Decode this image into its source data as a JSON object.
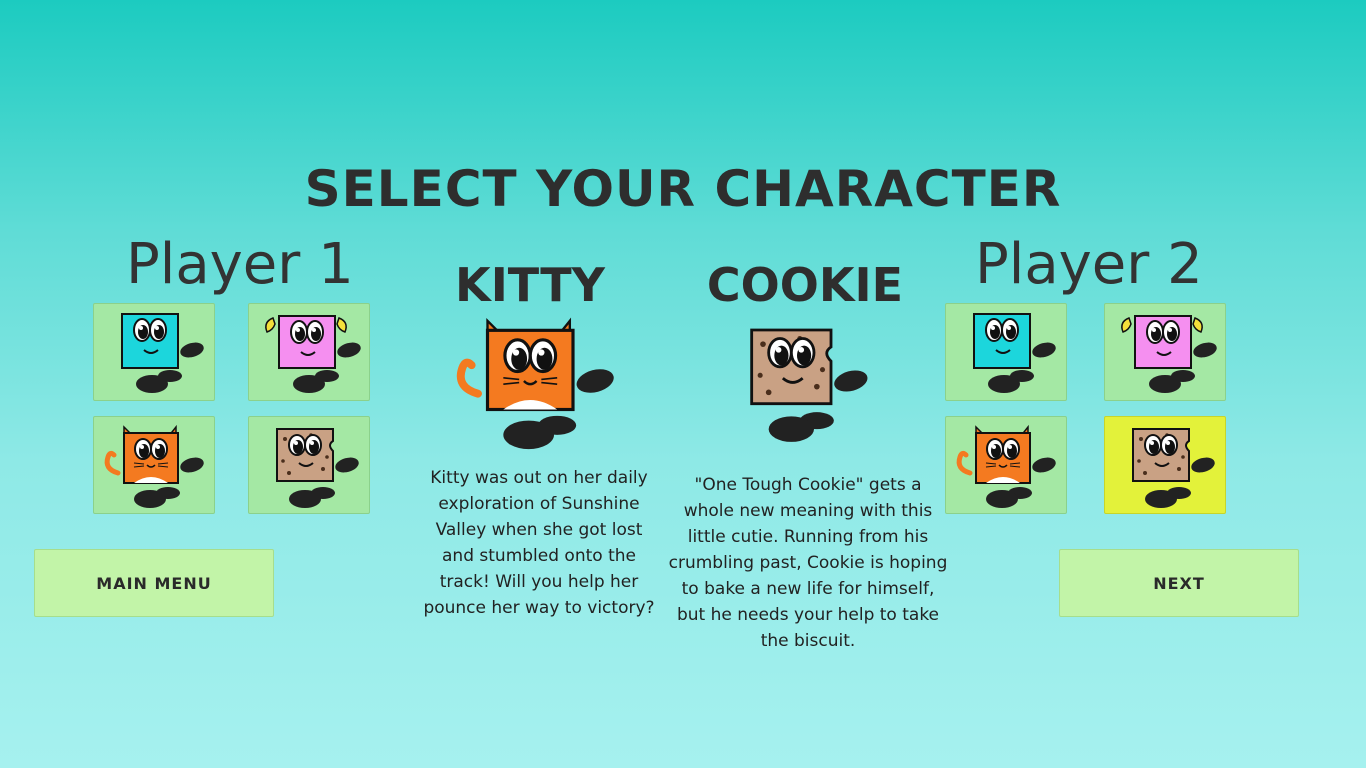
{
  "title": "SELECT YOUR CHARACTER",
  "players": {
    "p1": {
      "label": "Player 1"
    },
    "p2": {
      "label": "Player 2"
    }
  },
  "characters": {
    "kitty": {
      "name": "KITTY",
      "description": "Kitty was out on her daily exploration of Sunshine Valley when she got lost and stumbled onto the track! Will you help her pounce her way to victory?",
      "color": "#f47a20"
    },
    "cookie": {
      "name": "COOKIE",
      "description": "\"One Tough Cookie\" gets a whole new meaning with this little cutie. Running from his crumbling past, Cookie is hoping to bake a new life for himself, but he needs your help to take the biscuit.",
      "color": "#c9a184"
    }
  },
  "grid_characters": [
    "blue",
    "pink",
    "kitty",
    "cookie"
  ],
  "selections": {
    "p1": "kitty",
    "p2": "cookie"
  },
  "colors": {
    "blue": "#1cd6dc",
    "pink": "#f58ff0",
    "kitty": "#f47a20",
    "cookie": "#c9a184",
    "tile": "#a4e8a4",
    "tile_selected": "#e3f23a",
    "button": "#c2f4a8"
  },
  "buttons": {
    "main_menu": "MAIN MENU",
    "next": "NEXT"
  }
}
